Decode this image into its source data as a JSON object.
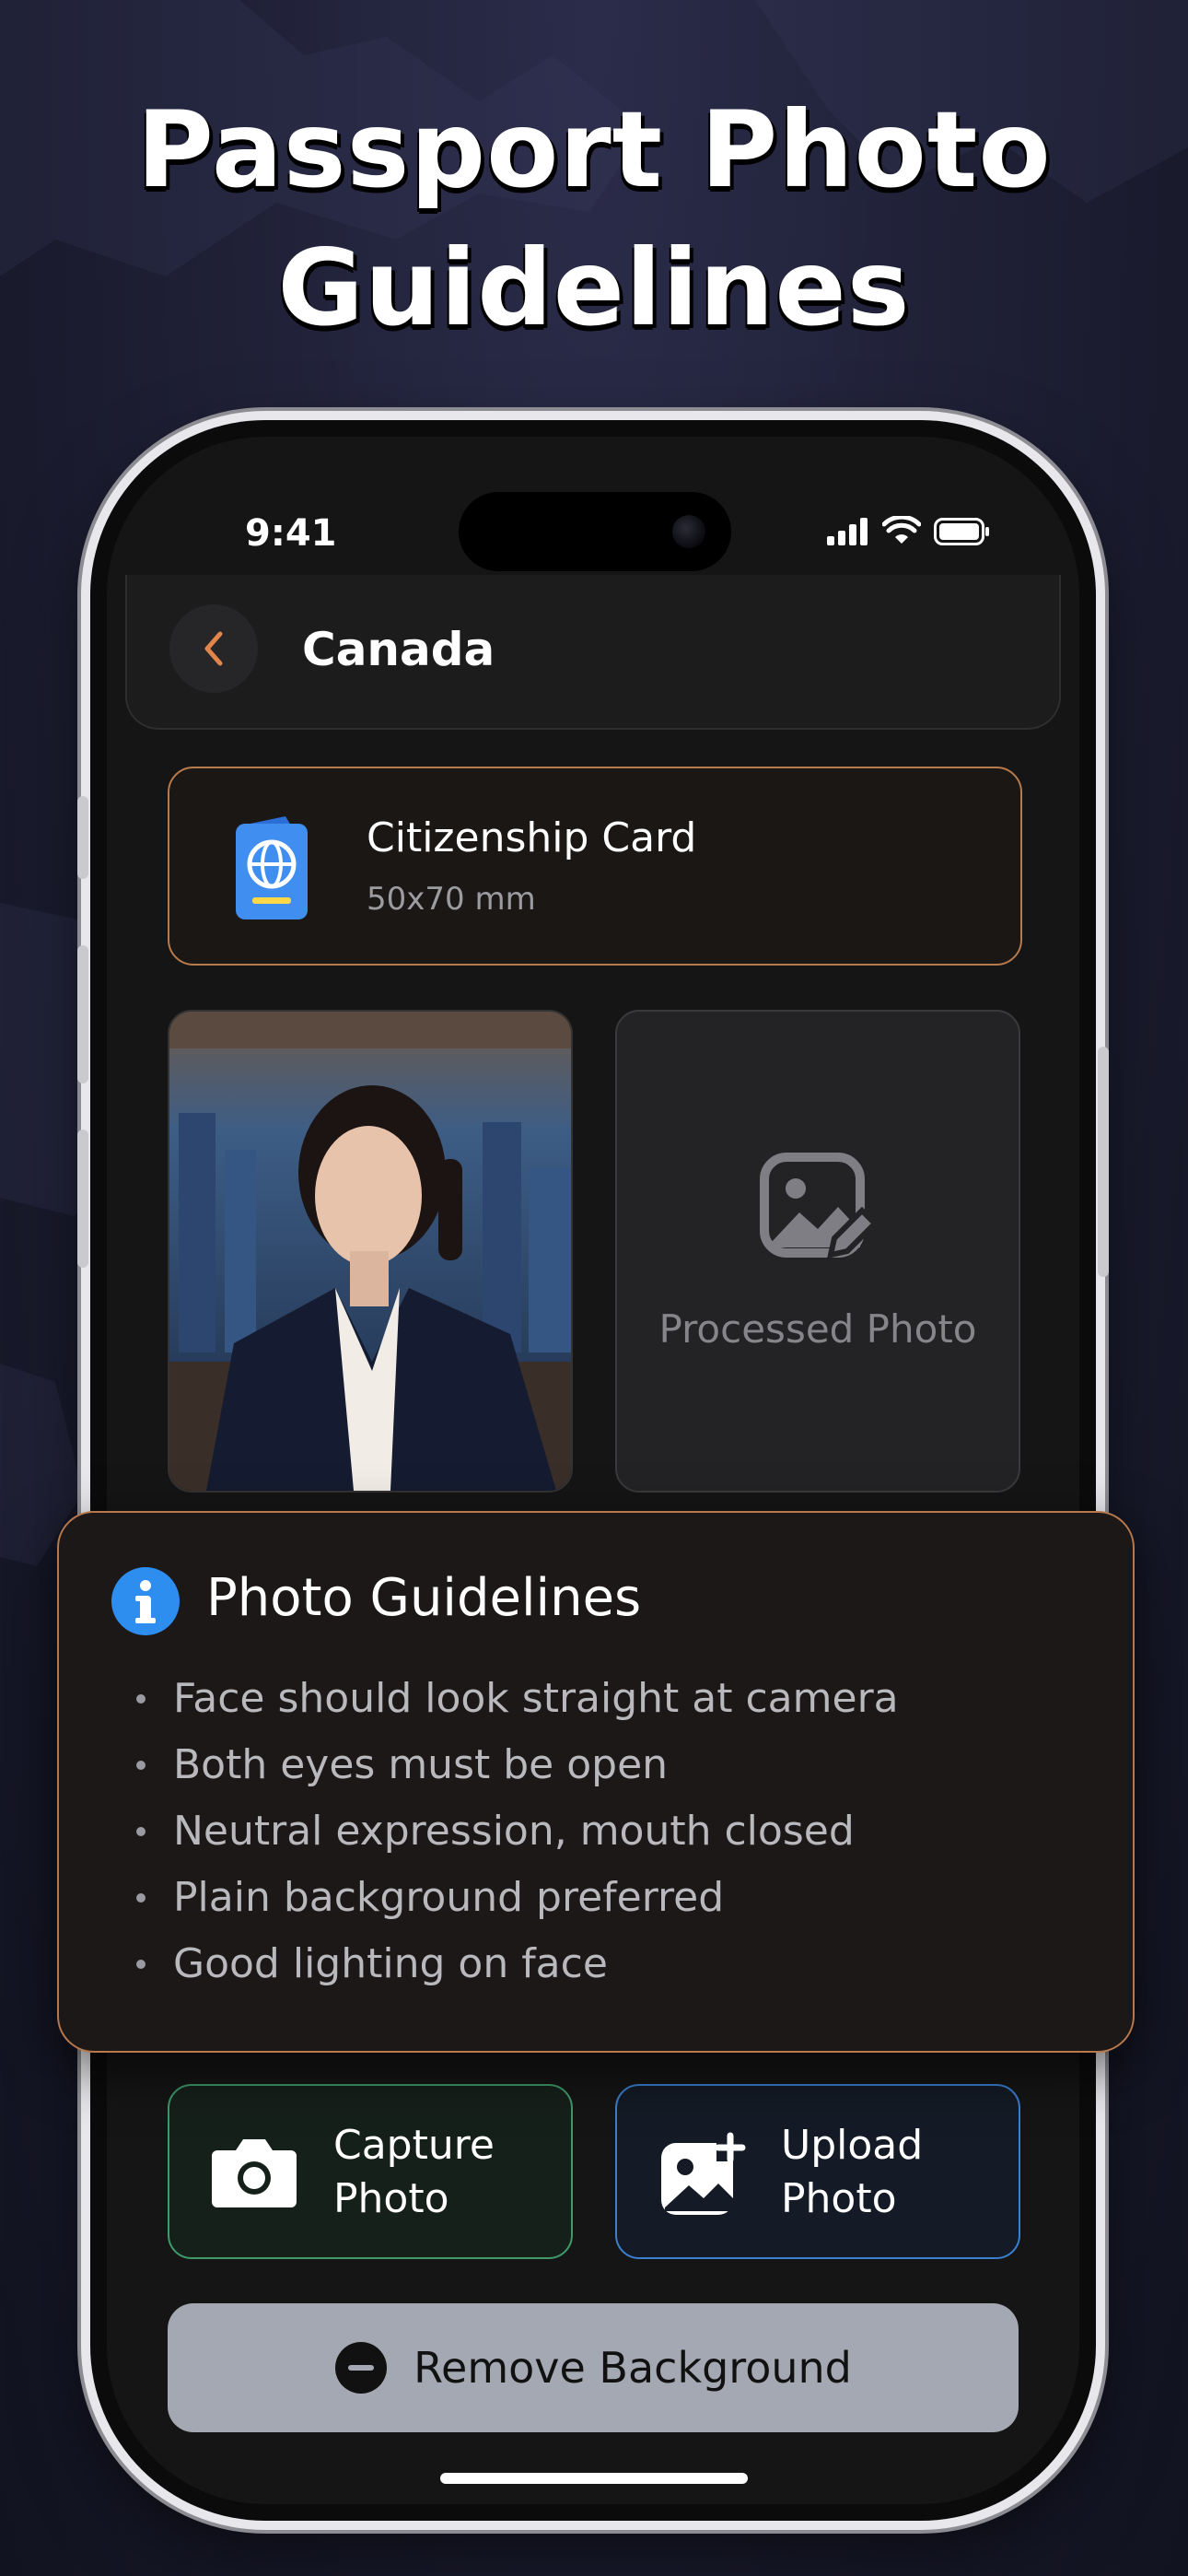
{
  "headline": {
    "line1": "Passport Photo",
    "line2": "Guidelines"
  },
  "status_bar": {
    "time": "9:41",
    "icons": [
      "signal-icon",
      "wifi-icon",
      "battery-icon"
    ]
  },
  "header": {
    "back_icon": "chevron-left-icon",
    "title": "Canada"
  },
  "document": {
    "icon": "passport-icon",
    "title": "Citizenship Card",
    "size": "50x70 mm"
  },
  "photos": {
    "original_alt": "Original portrait photo",
    "processed_label": "Processed Photo",
    "processed_icon": "image-edit-icon"
  },
  "guidelines": {
    "icon": "info-icon",
    "title": "Photo Guidelines",
    "items": [
      "Face should look straight at camera",
      "Both eyes must be open",
      "Neutral expression, mouth closed",
      "Plain background preferred",
      "Good lighting on face"
    ]
  },
  "actions": {
    "capture": {
      "icon": "camera-icon",
      "line1": "Capture",
      "line2": "Photo"
    },
    "upload": {
      "icon": "image-add-icon",
      "line1": "Upload",
      "line2": "Photo"
    },
    "remove_bg": {
      "icon": "minus-circle-icon",
      "label": "Remove Background"
    }
  },
  "colors": {
    "accent_orange": "#b77a4c",
    "capture_border": "#3f9a6a",
    "upload_border": "#3a7fd0",
    "info_blue": "#2d8ef0"
  }
}
